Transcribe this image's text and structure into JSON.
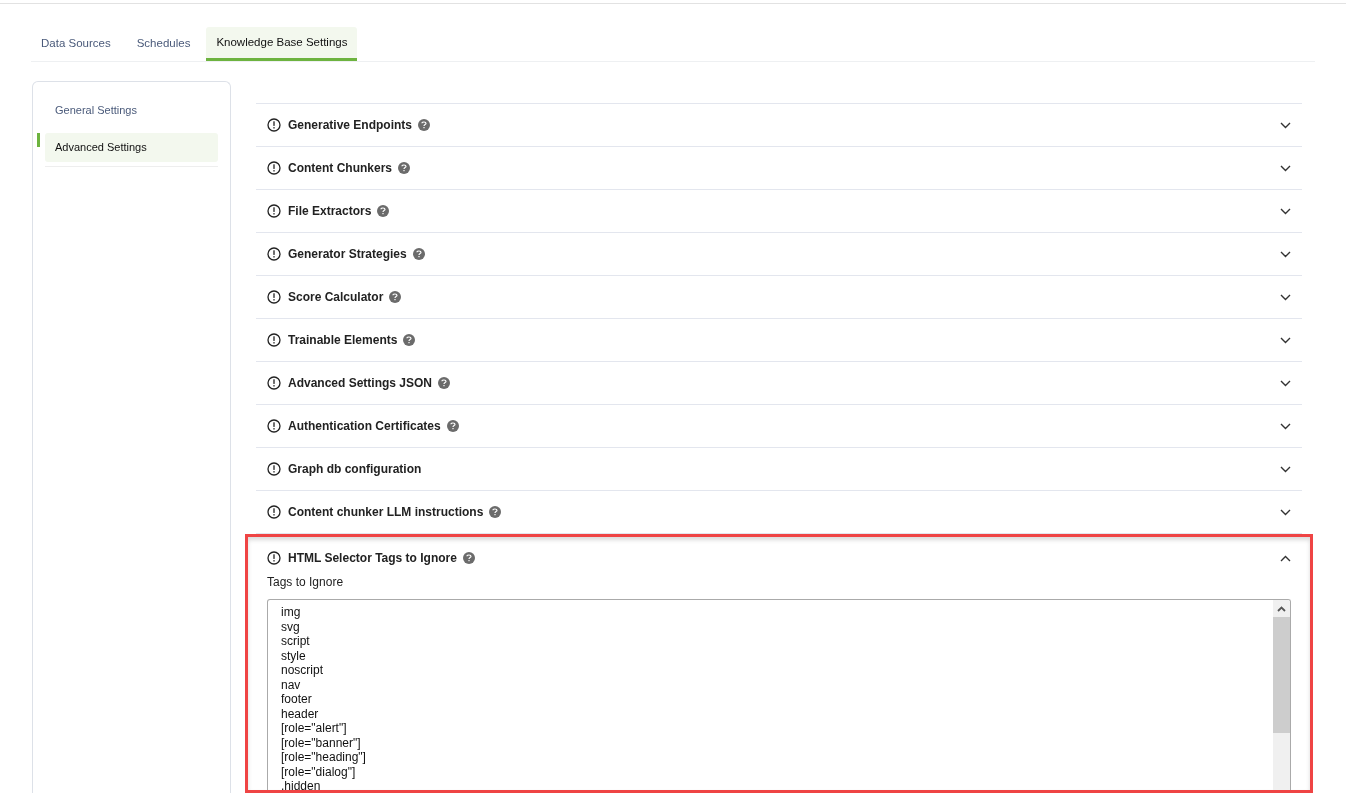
{
  "tabs": [
    {
      "label": "Data Sources",
      "selected": false
    },
    {
      "label": "Schedules",
      "selected": false
    },
    {
      "label": "Knowledge Base Settings",
      "selected": true
    }
  ],
  "sidebar": {
    "items": [
      {
        "label": "General Settings",
        "selected": false
      },
      {
        "label": "Advanced Settings",
        "selected": true
      }
    ]
  },
  "sections": [
    {
      "title": "Generative Endpoints",
      "help": true,
      "expanded": false
    },
    {
      "title": "Content Chunkers",
      "help": true,
      "expanded": false
    },
    {
      "title": "File Extractors",
      "help": true,
      "expanded": false
    },
    {
      "title": "Generator Strategies",
      "help": true,
      "expanded": false
    },
    {
      "title": "Score Calculator",
      "help": true,
      "expanded": false
    },
    {
      "title": "Trainable Elements",
      "help": true,
      "expanded": false
    },
    {
      "title": "Advanced Settings JSON",
      "help": true,
      "expanded": false
    },
    {
      "title": "Authentication Certificates",
      "help": true,
      "expanded": false
    },
    {
      "title": "Graph db configuration",
      "help": false,
      "expanded": false
    },
    {
      "title": "Content chunker LLM instructions",
      "help": true,
      "expanded": false
    },
    {
      "title": "HTML Selector Tags to Ignore",
      "help": true,
      "expanded": true,
      "highlighted": true,
      "field": {
        "label": "Tags to Ignore",
        "lines": [
          "img",
          "svg",
          "script",
          "style",
          "noscript",
          "nav",
          "footer",
          "header",
          "[role=\"alert\"]",
          "[role=\"banner\"]",
          "[role=\"heading\"]",
          "[role=\"dialog\"]",
          ".hidden"
        ]
      }
    }
  ]
}
